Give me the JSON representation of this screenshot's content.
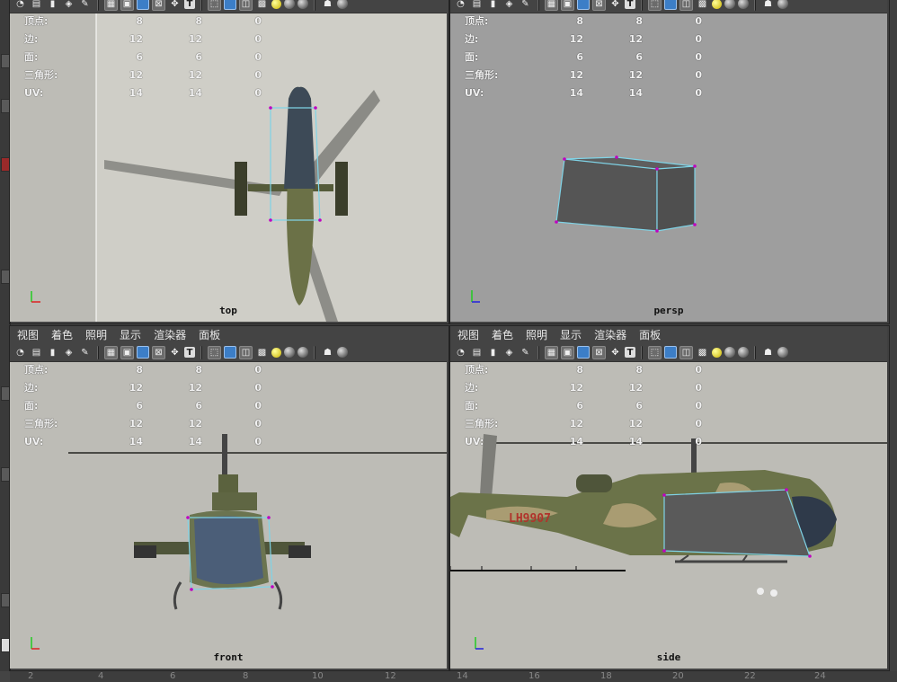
{
  "menu": [
    "视图",
    "着色",
    "照明",
    "显示",
    "渲染器",
    "面板"
  ],
  "hud": {
    "rows": [
      {
        "label": "顶点:",
        "a": "8",
        "b": "8",
        "c": "0"
      },
      {
        "label": "边:",
        "a": "12",
        "b": "12",
        "c": "0"
      },
      {
        "label": "面:",
        "a": "6",
        "b": "6",
        "c": "0"
      },
      {
        "label": "三角形:",
        "a": "12",
        "b": "12",
        "c": "0"
      },
      {
        "label": "UV:",
        "a": "14",
        "b": "14",
        "c": "0"
      }
    ]
  },
  "viewports": {
    "top": "top",
    "persp": "persp",
    "front": "front",
    "side": "side"
  },
  "side_decal": "LH9907",
  "ruler": [
    "2",
    "4",
    "6",
    "8",
    "10",
    "12",
    "14",
    "16",
    "18",
    "20",
    "22",
    "24"
  ],
  "colors": {
    "selection": "#7fd3e6",
    "vertex": "#c000c0",
    "box": "#5a5a5a",
    "olive": "#5f6a3e",
    "sand": "#a99c72"
  }
}
